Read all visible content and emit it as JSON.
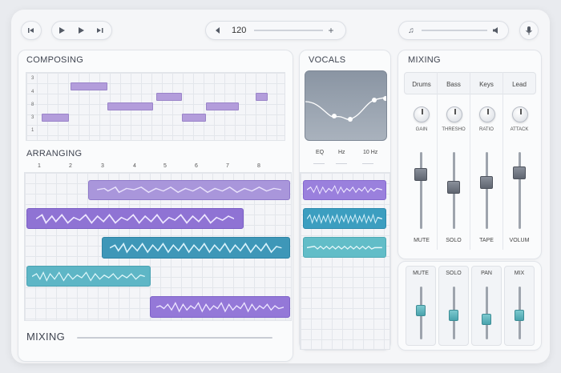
{
  "transport": {
    "tempo": "120"
  },
  "composing": {
    "title": "COMPOSING",
    "row_labels": [
      "3",
      "4",
      "8",
      "3",
      "1"
    ]
  },
  "arranging": {
    "title": "ARRANGING",
    "bars": [
      "1",
      "2",
      "3",
      "4",
      "5",
      "6",
      "7",
      "8"
    ]
  },
  "vocals": {
    "title": "VOCALS",
    "eq_labels": [
      "EQ",
      "Hz",
      "10 Hz"
    ]
  },
  "mixing_top": {
    "title": "MIXING",
    "channels": [
      "Drums",
      "Bass",
      "Keys",
      "Lead"
    ],
    "knob_labels": [
      "GAIN",
      "THRESHO",
      "RATIO",
      "ATTACK"
    ],
    "fader_labels": [
      "MUTE",
      "SOLO",
      "TAPE",
      "VOLUM"
    ],
    "fader_levels": [
      0.75,
      0.55,
      0.62,
      0.78
    ]
  },
  "mixing_bottom": {
    "title": "MIXING",
    "strip_labels": [
      "MUTE",
      "SOLO",
      "PAN",
      "MIX"
    ],
    "fader_levels": [
      0.55,
      0.45,
      0.35,
      0.45
    ]
  },
  "colors": {
    "purple": "#9d87d6",
    "blue": "#3f9bbd",
    "teal": "#62bcc7"
  }
}
